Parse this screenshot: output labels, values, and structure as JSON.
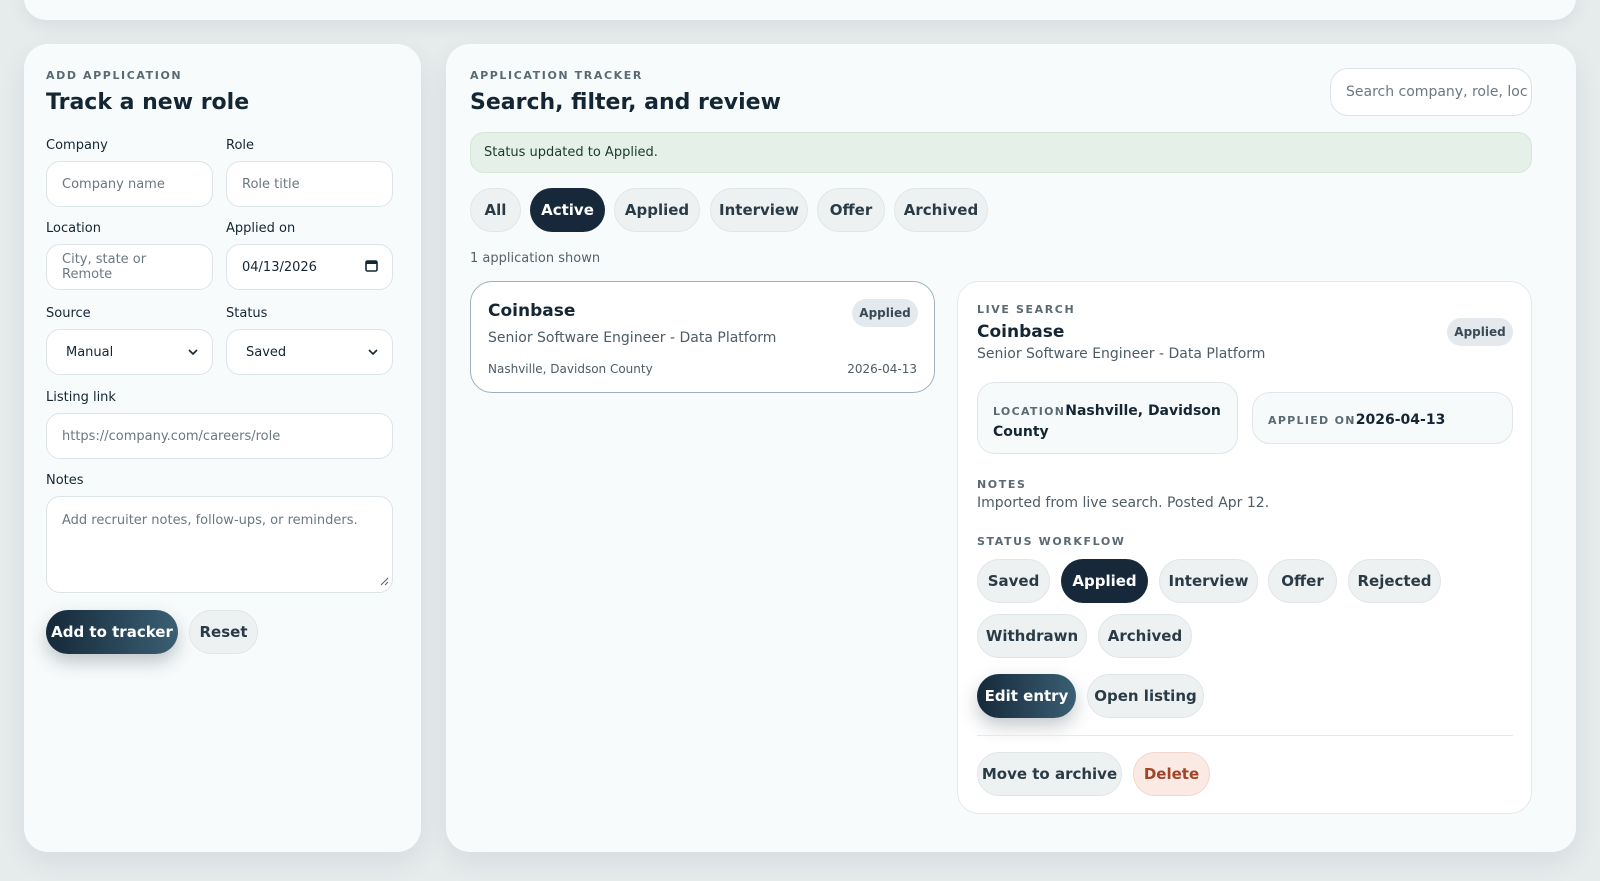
{
  "add_form": {
    "eyebrow": "ADD APPLICATION",
    "title": "Track a new role",
    "company": {
      "label": "Company",
      "placeholder": "Company name"
    },
    "role": {
      "label": "Role",
      "placeholder": "Role title"
    },
    "location": {
      "label": "Location",
      "placeholder": "City, state or Remote"
    },
    "applied_on": {
      "label": "Applied on",
      "value": "04/13/2026"
    },
    "source": {
      "label": "Source",
      "value": "Manual"
    },
    "status": {
      "label": "Status",
      "value": "Saved"
    },
    "listing_link": {
      "label": "Listing link",
      "placeholder": "https://company.com/careers/role"
    },
    "notes": {
      "label": "Notes",
      "placeholder": "Add recruiter notes, follow-ups, or reminders."
    },
    "add_button": "Add to tracker",
    "reset_button": "Reset"
  },
  "tracker": {
    "eyebrow": "APPLICATION TRACKER",
    "title": "Search, filter, and review",
    "search_placeholder": "Search company, role, loc",
    "status_message": "Status updated to Applied.",
    "filters": [
      "All",
      "Active",
      "Applied",
      "Interview",
      "Offer",
      "Archived"
    ],
    "active_filter": "Active",
    "count_text": "1 application shown",
    "list": [
      {
        "company": "Coinbase",
        "role": "Senior Software Engineer - Data Platform",
        "location": "Nashville, Davidson County",
        "date": "2026-04-13",
        "badge": "Applied"
      }
    ]
  },
  "detail": {
    "eyebrow": "LIVE SEARCH",
    "company": "Coinbase",
    "role": "Senior Software Engineer - Data Platform",
    "badge": "Applied",
    "location_label": "LOCATION",
    "location_value": "Nashville, Davidson County",
    "applied_label": "APPLIED ON",
    "applied_value": "2026-04-13",
    "notes_label": "NOTES",
    "notes_text": "Imported from live search. Posted Apr 12.",
    "workflow_label": "STATUS WORKFLOW",
    "workflow": [
      "Saved",
      "Applied",
      "Interview",
      "Offer",
      "Rejected",
      "Withdrawn",
      "Archived"
    ],
    "active_status": "Applied",
    "edit_button": "Edit entry",
    "open_button": "Open listing",
    "archive_button": "Move to archive",
    "delete_button": "Delete"
  },
  "colors": {
    "page_bg": "#e6ebec",
    "panel_bg": "#f8fbfb",
    "accent_dark": "#16283a",
    "status_bar_bg": "#e4f0e8",
    "danger": "#a24428"
  }
}
